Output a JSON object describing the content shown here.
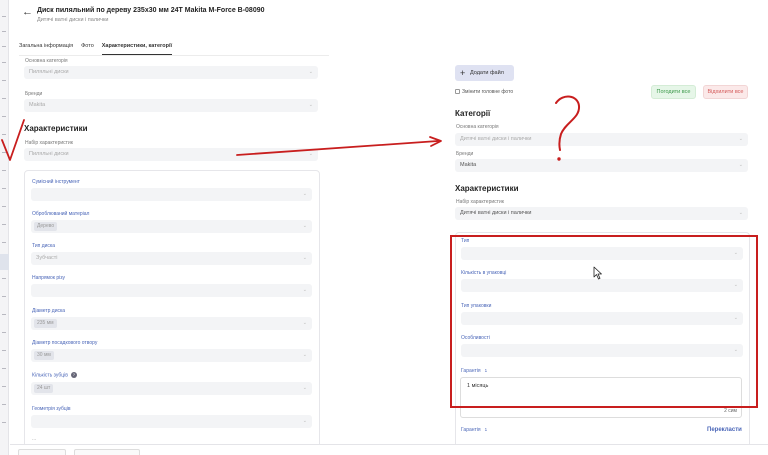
{
  "header": {
    "title": "Диск пиляльний по дереву 235x30 мм 24T Makita M-Force B-08090",
    "subtitle": "Дитячі ватні диски і палички"
  },
  "tabs": [
    {
      "label": "Загальна інформація",
      "active": false
    },
    {
      "label": "Фото",
      "active": false
    },
    {
      "label": "Характеристики, категорії",
      "active": true
    }
  ],
  "left": {
    "main_category": {
      "label": "Основна категорія",
      "value": "Пиляльні диски"
    },
    "brand": {
      "label": "Бренди",
      "value": "Makita"
    },
    "characteristics_title": "Характеристики",
    "char_set": {
      "label": "Набір характеристик",
      "value": "Пиляльні диски"
    },
    "fields": [
      {
        "label": "Сумісний інструмент",
        "value": ""
      },
      {
        "label": "Оброблюваний матеріал",
        "value": "Дерево"
      },
      {
        "label": "Тип диска",
        "value": "Зубчасті"
      },
      {
        "label": "Напрямок різу",
        "value": ""
      },
      {
        "label": "Діаметр диска",
        "value": "235 мм"
      },
      {
        "label": "Діаметр посадкового отвору",
        "value": "30 мм"
      },
      {
        "label": "Кількість зубців",
        "value": "24 шт"
      },
      {
        "label": "Геометрія зубців",
        "value": ""
      }
    ],
    "more": "..."
  },
  "right": {
    "add_file_label": "Додати файл",
    "change_main_photo": "Змінити головне фото",
    "agree_all": "Погодити все",
    "reject_all": "Відхилити все",
    "categories_title": "Категорії",
    "main_category": {
      "label": "Основна категорія",
      "value": "Дитячі ватні диски і палички"
    },
    "brand": {
      "label": "Бренди",
      "value": "Makita"
    },
    "characteristics_title": "Характеристики",
    "char_set": {
      "label": "Набір характеристик",
      "value": "Дитячі ватні диски і палички"
    },
    "fields": [
      {
        "label": "Тип",
        "value": ""
      },
      {
        "label": "Кількість в упаковці",
        "value": ""
      },
      {
        "label": "Тип упаковки",
        "value": ""
      },
      {
        "label": "Особливості",
        "value": ""
      }
    ],
    "warranty": {
      "label": "Гарантія",
      "badge": "1",
      "value": "1 місяць",
      "counter": "2 сим"
    },
    "warranty2": {
      "label": "Гарантія",
      "badge": "1"
    },
    "translate": "Перекласти"
  },
  "colors": {
    "annotation_red": "#c81e1e",
    "link_blue": "#4a66b8",
    "agree_green": "#3e9a4c",
    "reject_red": "#d45a5a"
  }
}
